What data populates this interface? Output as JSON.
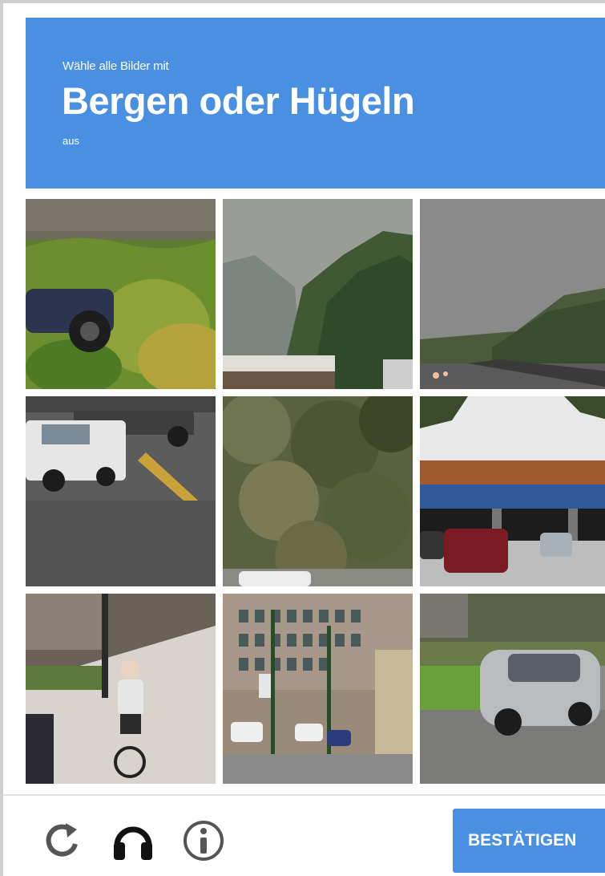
{
  "header": {
    "instruction": "Wähle alle Bilder mit",
    "target": "Bergen oder Hügeln",
    "suffix": "aus",
    "color": "#4a90e2"
  },
  "tiles": [
    {
      "name": "tile-car-in-grass"
    },
    {
      "name": "tile-foggy-mountain"
    },
    {
      "name": "tile-highway-hills"
    },
    {
      "name": "tile-pickup-truck"
    },
    {
      "name": "tile-hillside-vegetation"
    },
    {
      "name": "tile-bridge-underpass"
    },
    {
      "name": "tile-cyclist"
    },
    {
      "name": "tile-building-street"
    },
    {
      "name": "tile-silver-car"
    }
  ],
  "footer": {
    "reload_icon": "reload-icon",
    "audio_icon": "headphones-icon",
    "info_icon": "info-icon",
    "verify_label": "BESTÄTIGEN"
  }
}
